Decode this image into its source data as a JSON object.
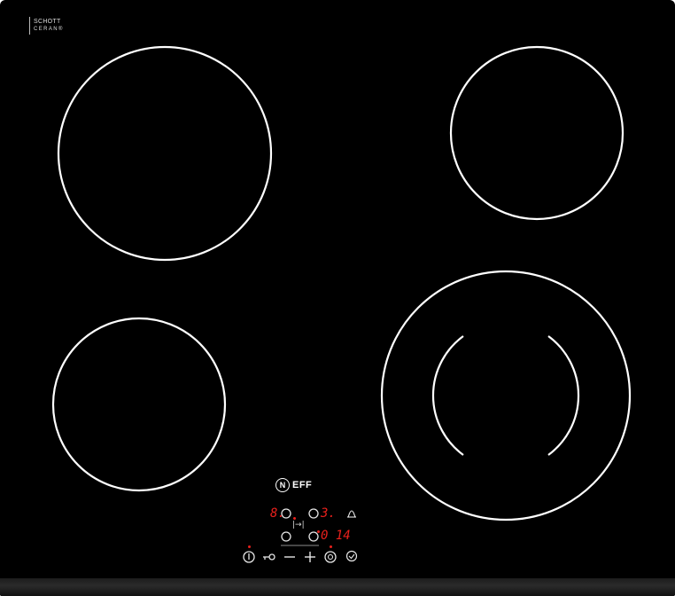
{
  "glass_logo": {
    "line1": "SCHOTT",
    "line2": "CERAN®"
  },
  "brand": {
    "badge": "N",
    "word": "EFF"
  },
  "cooking_zones": [
    {
      "name": "front-left-large-zone"
    },
    {
      "name": "rear-right-zone"
    },
    {
      "name": "rear-left-zone"
    },
    {
      "name": "front-right-dual-zone"
    }
  ],
  "control_panel": {
    "display_left": "8.",
    "display_right": "3.",
    "timer_display": "0 14",
    "timer_key_label": "|→|",
    "minus_label": "—",
    "plus_label": "+",
    "colors": {
      "display_red": "#e8201c",
      "symbol_white": "#e6e6e6"
    },
    "icons": [
      "power-icon",
      "child-lock-key-icon",
      "minus-icon",
      "plus-icon",
      "timer-dial-icon",
      "clock-icon",
      "bell-icon",
      "zone-select-ring-icon"
    ]
  }
}
